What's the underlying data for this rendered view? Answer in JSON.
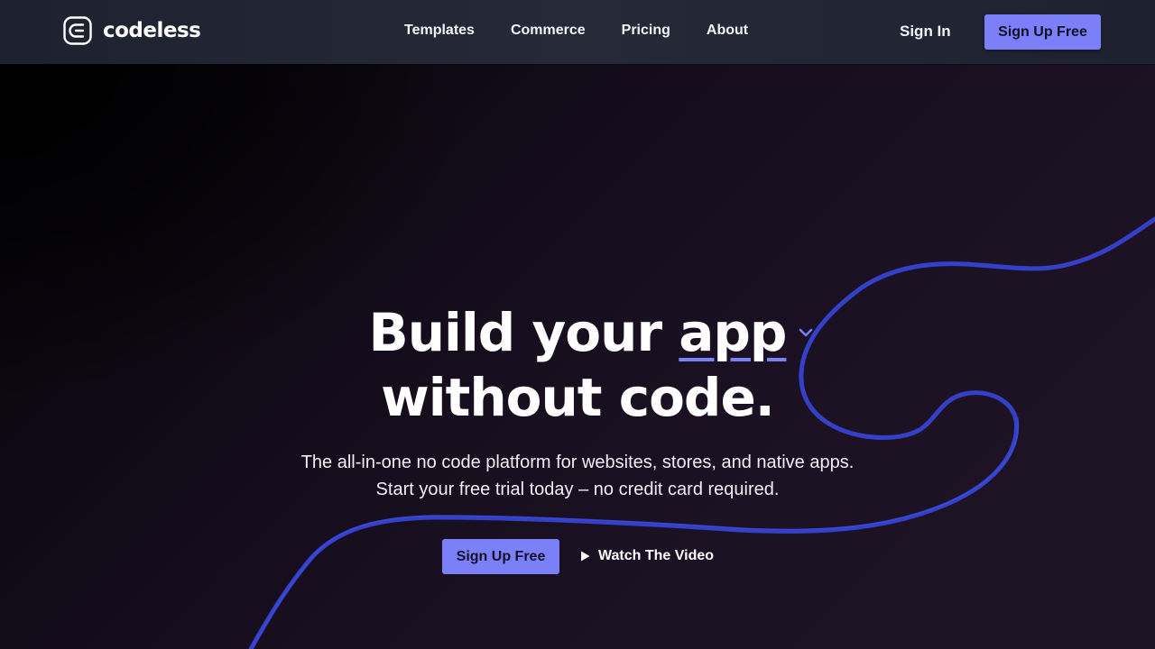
{
  "brand": {
    "name": "codeless",
    "logo_icon": "codeless-c-logo-icon"
  },
  "nav": {
    "items": [
      {
        "label": "Templates"
      },
      {
        "label": "Commerce"
      },
      {
        "label": "Pricing"
      },
      {
        "label": "About"
      }
    ],
    "sign_in": "Sign In",
    "sign_up": "Sign Up Free"
  },
  "hero": {
    "headline_part1": "Build your",
    "keyword": "app",
    "keyword_dropdown_icon": "chevron-down-icon",
    "headline_line2": "without code.",
    "subtext_line1": "The all-in-one no code platform for websites, stores, and native apps.",
    "subtext_line2": "Start your free trial today – no credit card required.",
    "cta_primary": "Sign Up Free",
    "cta_secondary": "Watch The Video",
    "cta_secondary_icon": "play-icon"
  },
  "colors": {
    "accent": "#7b7ff8",
    "header_bg": "#222533",
    "hero_bg": "#1b1222",
    "squiggle": "#3540c8"
  }
}
